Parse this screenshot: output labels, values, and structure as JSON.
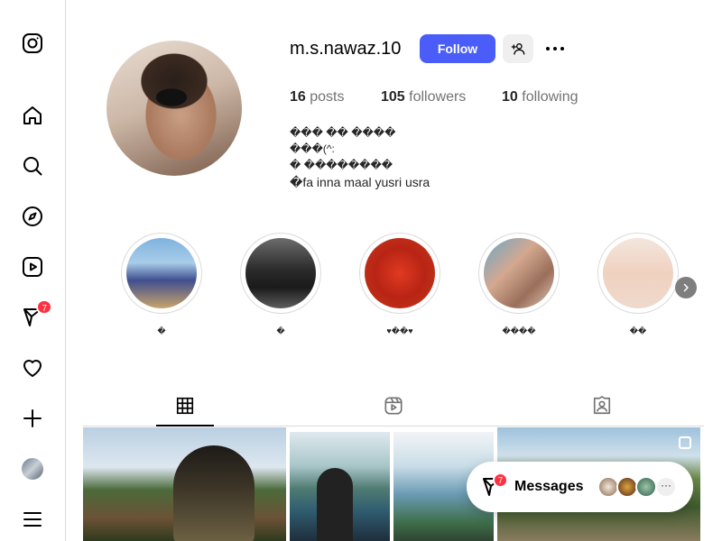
{
  "sidebar": {
    "items": [
      {
        "name": "instagram-logo-icon"
      },
      {
        "name": "home-icon"
      },
      {
        "name": "search-icon"
      },
      {
        "name": "explore-icon"
      },
      {
        "name": "reels-icon"
      },
      {
        "name": "messages-icon",
        "badge": "7"
      },
      {
        "name": "notifications-icon"
      },
      {
        "name": "create-icon"
      },
      {
        "name": "profile-avatar"
      },
      {
        "name": "more-menu-icon"
      }
    ]
  },
  "profile": {
    "username": "m.s.nawaz.10",
    "follow_label": "Follow",
    "stats": {
      "posts_count": "16",
      "posts_label": "posts",
      "followers_count": "105",
      "followers_label": "followers",
      "following_count": "10",
      "following_label": "following"
    },
    "bio": [
      "��� �� ����",
      "���(^:",
      "� ��������",
      "�fa inna maal yusri usra"
    ]
  },
  "highlights": [
    {
      "label": "�"
    },
    {
      "label": "�"
    },
    {
      "label": "♥��♥"
    },
    {
      "label": "����"
    },
    {
      "label": "��"
    }
  ],
  "tabs": [
    {
      "name": "posts-tab",
      "icon": "grid-icon",
      "active": true
    },
    {
      "name": "reels-tab",
      "icon": "reels-icon",
      "active": false
    },
    {
      "name": "tagged-tab",
      "icon": "tagged-icon",
      "active": false
    }
  ],
  "messages": {
    "label": "Messages",
    "badge": "7",
    "more": "···"
  },
  "colors": {
    "follow_button": "#4a5df9",
    "badge": "#ff3040",
    "border": "#dbdbdb"
  }
}
